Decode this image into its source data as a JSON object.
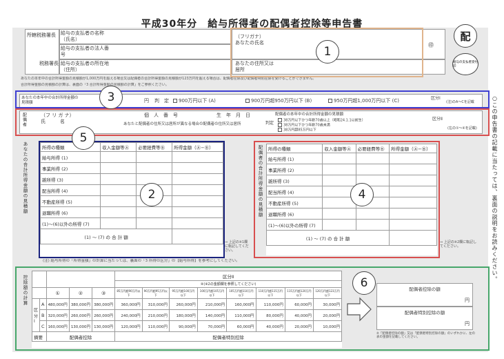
{
  "form": {
    "title": "平成30年分　給与所得者の配偶者控除等申告書",
    "stamp_label": "配",
    "stamp_sub": "給与の支払者受付印"
  },
  "header": {
    "tax_office": "所轄税務署長",
    "tax_office_bottom": "税務署長",
    "payer_name": "給与の支払者の名称（氏名）",
    "payer_number": "給与の支払者の法人番号",
    "payer_address": "給与の支払者の所在地（住所）",
    "furigana": "（フリガナ）",
    "your_name": "あなたの氏名",
    "your_address": "あなたの住所又は居所",
    "seal": "㊞",
    "note1": "あなたの本年中の合計所得金額の見積額が1,000万円を超える場合又は配偶者の合計所得金額の見積額が123万円を超える場合は、配偶者控除及び配偶者特別控除を受けることができません。",
    "note2": "合計所得金額の見積額の計算は、裏面の「3 合計所得金額の見積額の計算」をご参照ください。"
  },
  "section3": {
    "label": "あなたの本年中の合計所得金額の見積額",
    "unit": "円",
    "judge": "判　定",
    "opt_a": "900万円以下 (A)",
    "opt_b": "900万円超950万円以下 (B)",
    "opt_c": "950万円超1,000万円以下 (C)",
    "class_label": "区分Ⅰ",
    "note": "(注)のA〜Cを記載"
  },
  "section5": {
    "spouse": "配偶者",
    "furigana": "（フ リ ガ ナ）",
    "name": "氏　　　名",
    "mynumber": "個　人　番　号",
    "birth": "生　年　月　日",
    "addr_note": "あなたと配偶者の住所又は居所が異なる場合の配偶者の住所又は居所",
    "estimate": "配偶者の本年中の合計所得金額の見積額",
    "judge": "判定",
    "j1": "38万円以下かつ年齢70歳以上（昭和24.1.1以前生）",
    "j2": "38万円以下かつ年齢70歳未満",
    "j3": "38万円超85万円以下",
    "j4": "85万円超123万円以下",
    "class_label": "区分Ⅱ",
    "note": "(左の①〜④を記載)"
  },
  "calc_left": {
    "header_type": "所得の種類",
    "header_income": "収入金額等Ⓐ",
    "header_expense": "必要経費等Ⓑ",
    "header_amount": "所得金額（Ⓐ−Ⓑ）",
    "rows": [
      "給与所得 (1)",
      "事業所得 (2)",
      "雑所得 (3)",
      "配当所得 (4)",
      "不動産所得 (5)",
      "退職所得 (6)",
      "(1)〜(6)以外の所得 (7)"
    ],
    "total": "(1) 〜 (7) の 合 計 額",
    "side": "あなたの合計所得金額の見積額",
    "note": "⇒ 上記の※1欄に転記してください。"
  },
  "calc_right": {
    "side": "配偶者の合計所得金額の見積額",
    "total": "(1) 〜 (7) の 合 計 額",
    "note": "⇒ 上記の※2欄に転記してください。"
  },
  "footnote": "(注) 給与所得の「所得金額」の計算に当たっては、裏面の「3 所得の区分」の【給与所得】を参考にしてください。",
  "deduction_table": {
    "side": "控除額の計算",
    "class2_header": "区分Ⅱ",
    "note_header": "④(※2の金額欄を参照してください)",
    "col_heads": [
      "①",
      "②",
      "③",
      "85万円超90万円以下",
      "90万円超95万円以下",
      "95万円超100万円以下",
      "100万円超105万円以下",
      "105万円超110万円以下",
      "110万円超115万円以下",
      "115万円超120万円以下",
      "120万円超123万円以下"
    ],
    "class1": "区分Ⅰ",
    "rows": [
      {
        "k": "A",
        "v": [
          "480,000円",
          "380,000円",
          "380,000円",
          "360,000円",
          "310,000円",
          "260,000円",
          "210,000円",
          "160,000円",
          "110,000円",
          "60,000円",
          "30,000円"
        ]
      },
      {
        "k": "B",
        "v": [
          "320,000円",
          "260,000円",
          "260,000円",
          "240,000円",
          "210,000円",
          "180,000円",
          "140,000円",
          "110,000円",
          "80,000円",
          "40,000円",
          "20,000円"
        ]
      },
      {
        "k": "C",
        "v": [
          "160,000円",
          "130,000円",
          "130,000円",
          "120,000円",
          "110,000円",
          "90,000円",
          "70,000円",
          "60,000円",
          "40,000円",
          "20,000円",
          "10,000円"
        ]
      }
    ],
    "summary_label": "摘要",
    "summary_left": "配偶者控除",
    "summary_right": "配偶者特別控除",
    "result1": "配偶者控除の額",
    "result2": "配偶者特別控除の額",
    "yen": "円",
    "result_note": "※「配偶者控除の額」又は「配偶者特別控除の額」のいずれかに、左の表の金額を記載してください。"
  },
  "right_note": "○この申告書の記載に当たっては、裏面の説明をお読みください。",
  "markers": [
    "1",
    "2",
    "3",
    "4",
    "5",
    "6"
  ],
  "colors": {
    "marker1": "#e0b48c",
    "marker2": "#1a237e",
    "marker3": "#3e3fd1",
    "marker4": "#d84e4e",
    "marker5": "#d84e4e",
    "marker6": "#46a66a"
  }
}
